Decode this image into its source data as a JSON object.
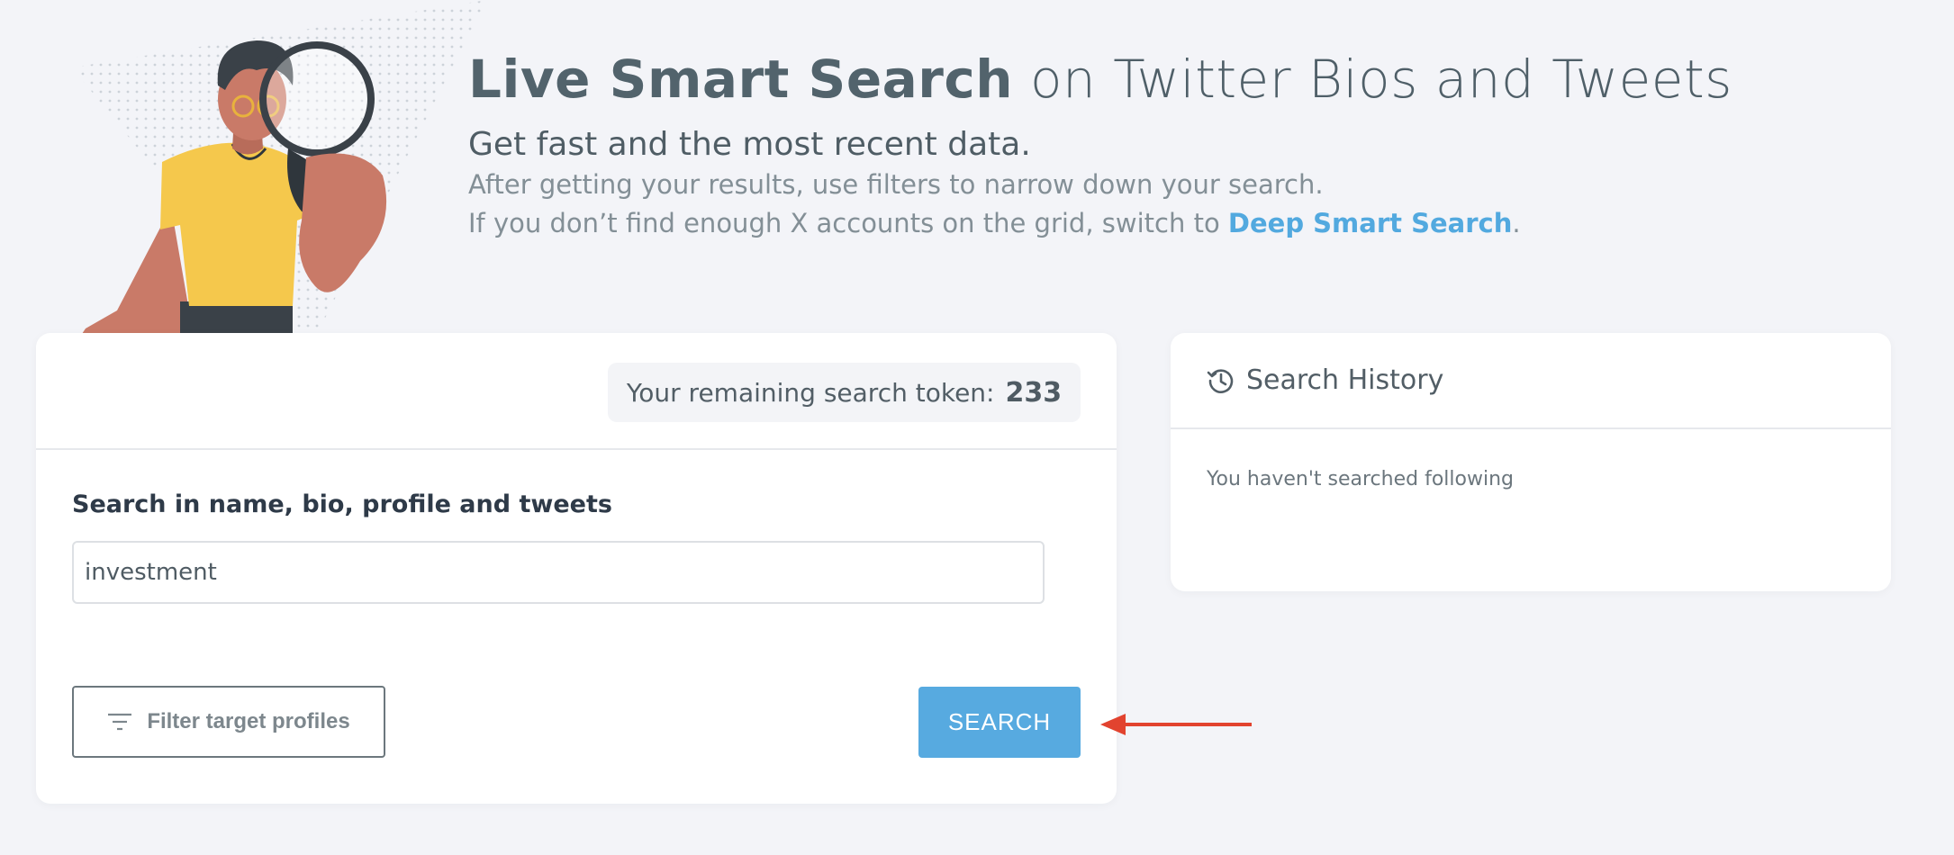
{
  "hero": {
    "title_bold": "Live Smart Search",
    "title_rest": " on Twitter Bios and Tweets",
    "subtitle": "Get fast and the most recent data.",
    "line1": "After getting your results, use filters to narrow down your search.",
    "line2_prefix": "If you don’t find enough X accounts on the grid, switch to ",
    "line2_link": "Deep Smart Search",
    "line2_suffix": ".",
    "illustration_icon": "person-with-magnifying-glass"
  },
  "search": {
    "token_label": "Your remaining search token:",
    "token_value": "233",
    "label": "Search in name, bio, profile and tweets",
    "input_value": "investment",
    "filter_icon": "filter-lines-icon",
    "filter_label": "Filter target profiles",
    "button_label": "SEARCH"
  },
  "history": {
    "icon": "history-icon",
    "title": "Search History",
    "empty_text": "You haven't searched following"
  },
  "colors": {
    "background": "#f3f4f8",
    "accent": "#57aae0",
    "link": "#52a9df",
    "annotation": "#e2432f"
  }
}
